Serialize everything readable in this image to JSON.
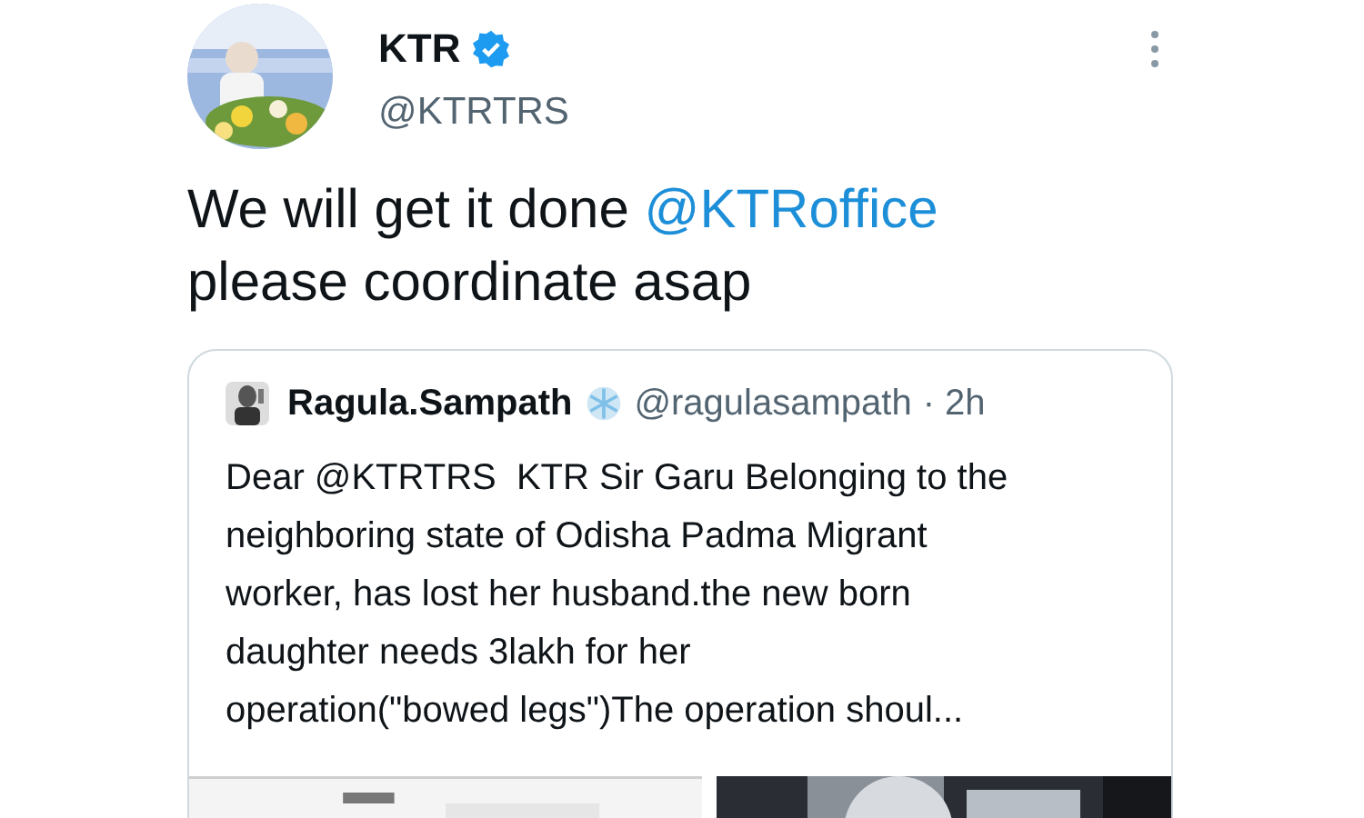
{
  "author": {
    "name": "KTR",
    "verified": true,
    "handle": "@KTRTRS"
  },
  "tweet": {
    "text_before": "We will get it done ",
    "mention": "@KTRoffice",
    "text_after": "\nplease coordinate asap"
  },
  "quoted_tweet": {
    "name": "Ragula.Sampath",
    "handle": "@ragulasampath",
    "time": "· 2h",
    "text": "Dear @KTRTRS  KTR Sir Garu Belonging to the\nneighboring state of Odisha Padma Migrant\nworker, has lost her husband.the new born\ndaughter needs 3lakh for her\noperation(\"bowed legs\")The operation shoul..."
  }
}
